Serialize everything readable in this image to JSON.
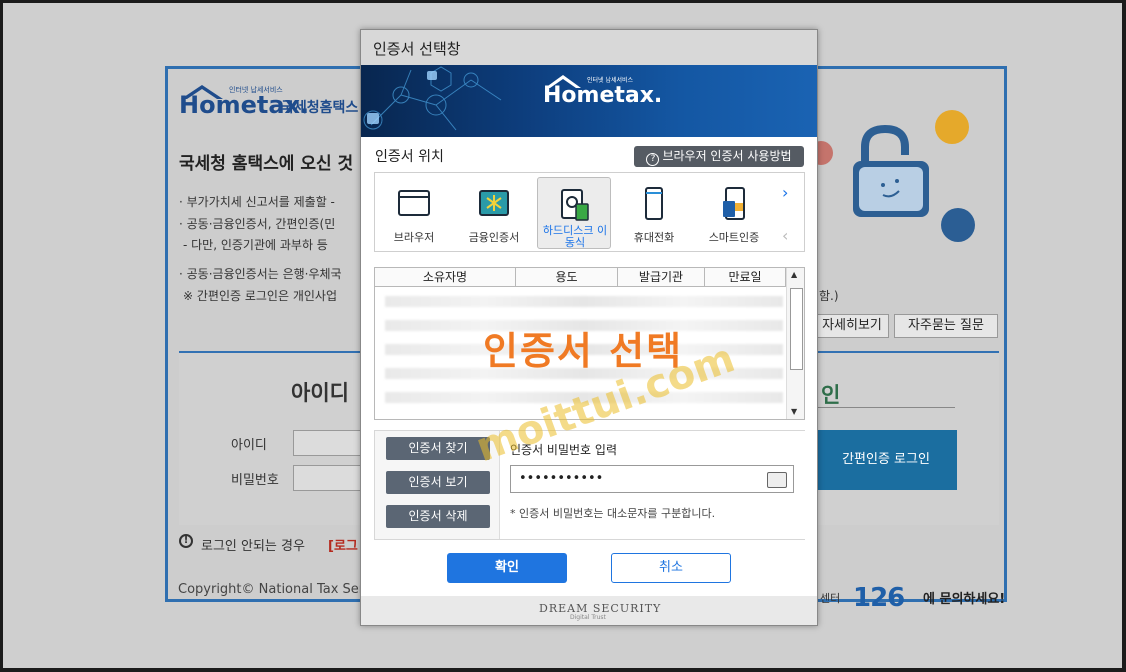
{
  "background": {
    "logo_small": "인터넷 납세서비스",
    "logo_main": "Hometax.",
    "logo_sub": "국세청홈택스",
    "hero_title": "국세청 홈택스에 오신 것",
    "bullets": [
      "· 부가가치세 신고서를 제출할 -",
      "· 공동·금융인증서, 간편인증(민",
      "  - 다만, 인증기관에 과부하 등",
      "· 공동·금융인증서는 은행·우체국",
      "※ 간편인증 로그인은 개인사업"
    ],
    "bullet_tail": "함.)",
    "btn_detail": "자세히보기",
    "btn_faq": "자주묻는 질문",
    "login_id_heading": "아이디",
    "login_right_heading": "인",
    "label_id": "아이디",
    "label_pw": "비밀번호",
    "simple_login_btn": "간편인증 로그인",
    "login_help": "로그인 안되는 경우",
    "login_help_link": "[로그",
    "copyright": "Copyright© National Tax Servi",
    "center_prefix": "센터",
    "center_number": "126",
    "center_suffix": "에 문의하세요!"
  },
  "modal": {
    "title": "인증서 선택창",
    "banner_small": "인터넷 납세서비스",
    "banner_logo": "Hometax.",
    "location_label": "인증서 위치",
    "help_button": "브라우저 인증서 사용방법",
    "locations": [
      {
        "label": "브라우저",
        "selected": false
      },
      {
        "label": "금융인증서",
        "selected": false
      },
      {
        "label": "하드디스크 이동식",
        "selected": true
      },
      {
        "label": "휴대전화",
        "selected": false
      },
      {
        "label": "스마트인증",
        "selected": false
      }
    ],
    "table_headers": [
      "소유자명",
      "용도",
      "발급기관",
      "만료일"
    ],
    "overlay_text": "인증서 선택",
    "buttons": {
      "find": "인증서 찾기",
      "view": "인증서 보기",
      "delete": "인증서 삭제"
    },
    "password_label": "인증서 비밀번호 입력",
    "password_value": "•••••••••••",
    "password_note": "* 인증서 비밀번호는 대소문자를 구분합니다.",
    "ok": "확인",
    "cancel": "취소",
    "footer_brand": "DREAM SECURITY",
    "footer_tag": "Digital Trust"
  },
  "watermark": "moittui.com",
  "colors": {
    "accent_blue": "#1f75e0",
    "hometax_navy": "#1f4c8c",
    "overlay_orange": "#f07a24",
    "button_gray": "#5b6674"
  }
}
